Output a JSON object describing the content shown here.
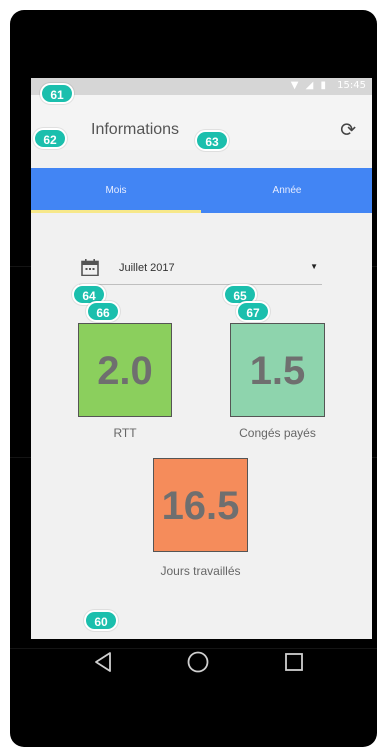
{
  "status_bar": {
    "time": "15:45"
  },
  "app_bar": {
    "title": "Informations",
    "refresh_icon": "refresh-icon"
  },
  "tabs": [
    {
      "label": "Mois",
      "selected": true
    },
    {
      "label": "Année",
      "selected": false
    }
  ],
  "month_selector": {
    "value": "Juillet 2017",
    "icon": "calendar-icon"
  },
  "tiles": [
    {
      "value": "2.0",
      "label": "RTT",
      "color": "#8bcf5d"
    },
    {
      "value": "1.5",
      "label": "Congés payés",
      "color": "#8ed4ad"
    },
    {
      "value": "16.5",
      "label": "Jours travaillés",
      "color": "#f58c5b"
    }
  ],
  "badges": {
    "b60": "60",
    "b61": "61",
    "b62": "62",
    "b63": "63",
    "b64": "64",
    "b65": "65",
    "b66": "66",
    "b67": "67"
  },
  "colors": {
    "tab_bar": "#4285f4",
    "tab_indicator": "#f7e88a",
    "badge": "#1bbfad"
  }
}
